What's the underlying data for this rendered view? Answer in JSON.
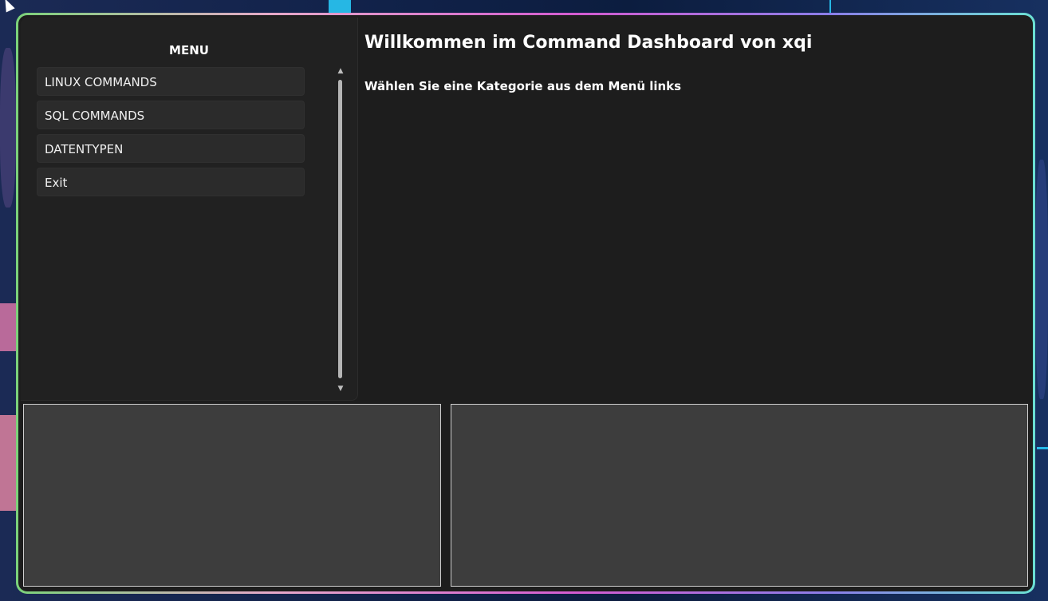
{
  "sidebar": {
    "title": "MENU",
    "items": [
      {
        "label": "LINUX COMMANDS"
      },
      {
        "label": "SQL COMMANDS"
      },
      {
        "label": "DATENTYPEN"
      },
      {
        "label": "Exit"
      }
    ]
  },
  "main": {
    "title": "Willkommen im Command Dashboard von xqi",
    "subtitle": "Wählen Sie eine Kategorie aus dem Menü links"
  },
  "colors": {
    "window_bg": "#1d1d1d",
    "sidebar_bg": "#212121",
    "menu_item_bg": "#2b2b2b",
    "panel_bg": "#3d3d3d",
    "border_gradient": [
      "#7bd27a",
      "#e6a9c9",
      "#d35bd0",
      "#8a7ee8",
      "#6be0d3"
    ]
  },
  "icons": {
    "scroll_up": "scroll-up-arrow-icon",
    "scroll_down": "scroll-down-arrow-icon",
    "cursor": "mouse-pointer-icon"
  }
}
